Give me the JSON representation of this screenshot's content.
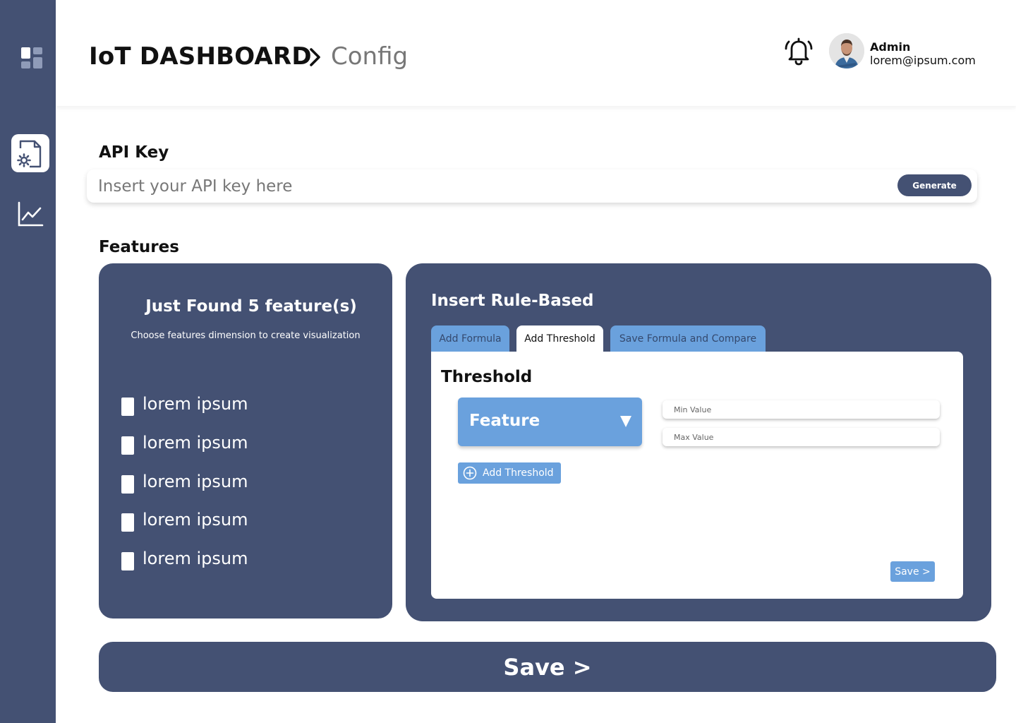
{
  "sidebar": {
    "items": [
      {
        "icon": "dashboard-icon"
      },
      {
        "icon": "config-file-gear-icon",
        "active": true
      },
      {
        "icon": "line-chart-icon"
      }
    ]
  },
  "header": {
    "breadcrumb_root": "IoT DASHBOARD",
    "breadcrumb_current": "Config",
    "user": {
      "name": "Admin",
      "email": "lorem@ipsum.com"
    }
  },
  "api_key": {
    "title": "API Key",
    "placeholder": "Insert your API key here",
    "value": "",
    "generate_label": "Generate"
  },
  "features": {
    "title": "Features",
    "found_title": "Just Found 5 feature(s)",
    "found_subtitle": "Choose features dimension to create visualization",
    "items": [
      {
        "label": "lorem ipsum",
        "checked": false
      },
      {
        "label": "lorem ipsum",
        "checked": false
      },
      {
        "label": "lorem ipsum",
        "checked": false
      },
      {
        "label": "lorem ipsum",
        "checked": false
      },
      {
        "label": "lorem ipsum",
        "checked": false
      }
    ]
  },
  "rules": {
    "title": "Insert Rule-Based",
    "tabs": [
      {
        "label": "Add Formula",
        "active": false
      },
      {
        "label": "Add Threshold",
        "active": true
      },
      {
        "label": "Save Formula and Compare",
        "active": false
      }
    ],
    "threshold": {
      "title": "Threshold",
      "feature_select": "Feature",
      "min_placeholder": "Min Value",
      "max_placeholder": "Max Value",
      "add_label": "Add Threshold",
      "save_label": "Save >"
    }
  },
  "footer": {
    "save_label": "Save >"
  },
  "colors": {
    "primary": "#445173",
    "accent": "#6aa1dd",
    "background": "#ffffff"
  }
}
